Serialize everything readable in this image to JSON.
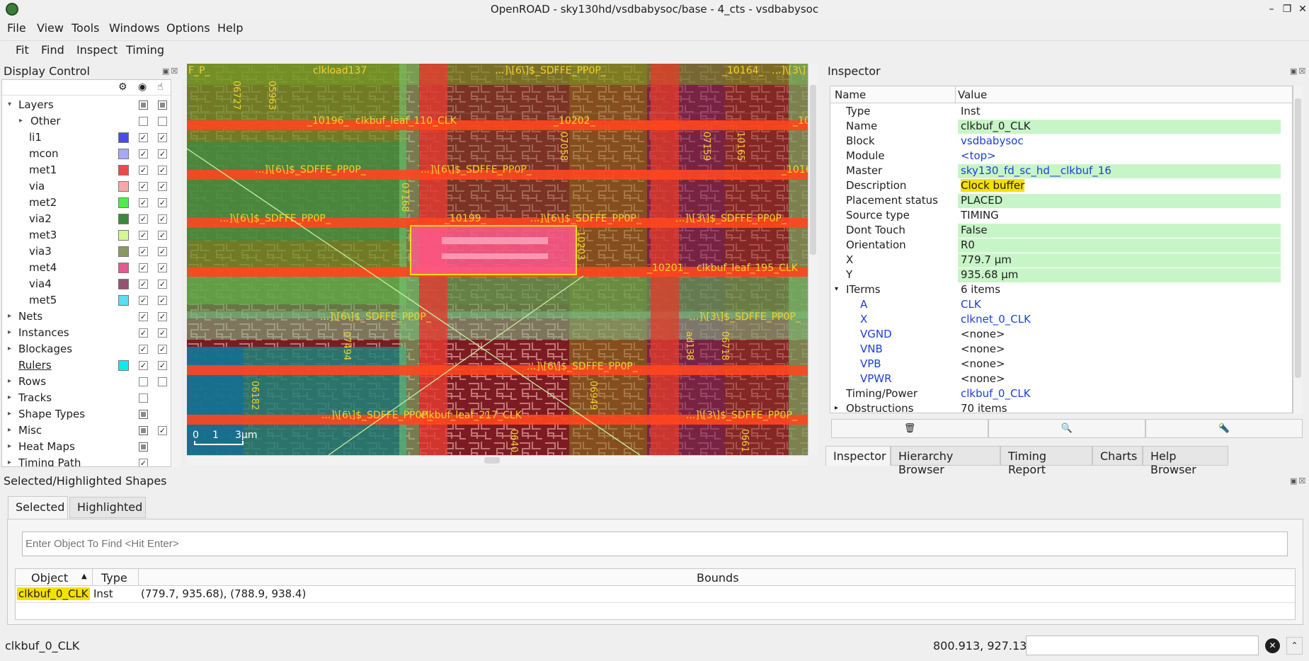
{
  "window": {
    "title": "OpenROAD - sky130hd/vsdbabysoc/base - 4_cts - vsdbabysoc"
  },
  "menu": [
    "File",
    "View",
    "Tools",
    "Windows",
    "Options",
    "Help"
  ],
  "toolbar": [
    "Fit",
    "Find",
    "Inspect",
    "Timing"
  ],
  "display_control": {
    "title": "Display Control",
    "rows": [
      {
        "label": "Layers",
        "level": 0,
        "arrow": "down",
        "color": null,
        "visible": "partial",
        "selectable": "partial"
      },
      {
        "label": "Other",
        "level": 1,
        "arrow": "right",
        "color": null,
        "visible": "off",
        "selectable": "off"
      },
      {
        "label": "li1",
        "level": 1,
        "arrow": "",
        "color": "#4a4af0",
        "visible": "on",
        "selectable": "on"
      },
      {
        "label": "mcon",
        "level": 1,
        "arrow": "",
        "color": "#a8a8f8",
        "visible": "on",
        "selectable": "on"
      },
      {
        "label": "met1",
        "level": 1,
        "arrow": "",
        "color": "#f04848",
        "visible": "on",
        "selectable": "on"
      },
      {
        "label": "via",
        "level": 1,
        "arrow": "",
        "color": "#f8a8a8",
        "visible": "on",
        "selectable": "on"
      },
      {
        "label": "met2",
        "level": 1,
        "arrow": "",
        "color": "#48f048",
        "visible": "on",
        "selectable": "on"
      },
      {
        "label": "via2",
        "level": 1,
        "arrow": "",
        "color": "#3a8a3a",
        "visible": "on",
        "selectable": "on"
      },
      {
        "label": "met3",
        "level": 1,
        "arrow": "",
        "color": "#d4f890",
        "visible": "on",
        "selectable": "on"
      },
      {
        "label": "via3",
        "level": 1,
        "arrow": "",
        "color": "#8a9a60",
        "visible": "on",
        "selectable": "on"
      },
      {
        "label": "met4",
        "level": 1,
        "arrow": "",
        "color": "#e85890",
        "visible": "on",
        "selectable": "on"
      },
      {
        "label": "via4",
        "level": 1,
        "arrow": "",
        "color": "#9a5070",
        "visible": "on",
        "selectable": "on"
      },
      {
        "label": "met5",
        "level": 1,
        "arrow": "",
        "color": "#58e0f0",
        "visible": "on",
        "selectable": "on"
      },
      {
        "label": "Nets",
        "level": 0,
        "arrow": "right",
        "color": null,
        "visible": "on",
        "selectable": "on"
      },
      {
        "label": "Instances",
        "level": 0,
        "arrow": "right",
        "color": null,
        "visible": "on",
        "selectable": "on"
      },
      {
        "label": "Blockages",
        "level": 0,
        "arrow": "right",
        "color": null,
        "visible": "on",
        "selectable": "on"
      },
      {
        "label": "Rulers",
        "level": 0,
        "arrow": "",
        "color": "#00f0f0",
        "visible": "on",
        "selectable": "on"
      },
      {
        "label": "Rows",
        "level": 0,
        "arrow": "right",
        "color": null,
        "visible": "off",
        "selectable": "off"
      },
      {
        "label": "Tracks",
        "level": 0,
        "arrow": "right",
        "color": null,
        "visible": "off",
        "selectable": null
      },
      {
        "label": "Shape Types",
        "level": 0,
        "arrow": "right",
        "color": null,
        "visible": "partial",
        "selectable": null
      },
      {
        "label": "Misc",
        "level": 0,
        "arrow": "right",
        "color": null,
        "visible": "partial",
        "selectable": "on"
      },
      {
        "label": "Heat Maps",
        "level": 0,
        "arrow": "right",
        "color": null,
        "visible": "partial",
        "selectable": null
      },
      {
        "label": "Timing Path",
        "level": 0,
        "arrow": "right",
        "color": null,
        "visible": "on",
        "selectable": null
      }
    ]
  },
  "layout": {
    "labels_h": [
      "F_P_",
      "clkload137",
      "...]\\[6\\]$_SDFFE_PP0P_",
      "_10164_",
      "...]\\[3\\]",
      "_10196_",
      "clkbuf_leaf_110_CLK",
      "_10202_",
      "_10",
      "...]\\[6\\]$_SDFFE_PP0P_",
      "...]\\[6\\]$_SDFFE_PP0P_",
      "_1016",
      "...]\\[6\\]$_SDFFE_PP0P_",
      "_10199_",
      "...]\\[6\\]$_SDFFE_PP0P_",
      "...]\\[3\\]$_SDFFE_PP0P_",
      "_10201_",
      "clkbuf_leaf_195_CLK",
      "...]\\[6\\]$_SDFFE_PP0P_",
      "...]\\[3\\]$_SDFFE_PP0P_",
      "...]\\[6\\]$_SDFFE_PP0P_",
      "...]\\[6\\]$_SDFFE_PP0P_",
      "clkbuf_leaf_217_CLK",
      "...]\\[3\\]$_SDFFE_PP0P_"
    ],
    "labels_v": [
      "06727",
      "05963",
      "07168",
      "07058",
      "07159",
      "10165",
      "10203",
      "07494",
      "ad138",
      "06718",
      "06182",
      "06949",
      "0640",
      "0661"
    ],
    "scale": {
      "ticks": [
        "0",
        "1"
      ],
      "unit": "3µm"
    }
  },
  "inspector": {
    "title": "Inspector",
    "headers": [
      "Name",
      "Value"
    ],
    "rows": [
      {
        "name": "Type",
        "value": "Inst",
        "style": "",
        "indent": 1,
        "arrow": ""
      },
      {
        "name": "Name",
        "value": "clkbuf_0_CLK",
        "style": "green",
        "indent": 1,
        "arrow": ""
      },
      {
        "name": "Block",
        "value": "vsdbabysoc",
        "style": "link",
        "indent": 1,
        "arrow": ""
      },
      {
        "name": "Module",
        "value": "<top>",
        "style": "link",
        "indent": 1,
        "arrow": ""
      },
      {
        "name": "Master",
        "value": "sky130_fd_sc_hd__clkbuf_16",
        "style": "green link",
        "indent": 1,
        "arrow": ""
      },
      {
        "name": "Description",
        "value": "Clock buffer",
        "style": "yellow",
        "indent": 1,
        "arrow": ""
      },
      {
        "name": "Placement status",
        "value": "PLACED",
        "style": "green",
        "indent": 1,
        "arrow": ""
      },
      {
        "name": "Source type",
        "value": "TIMING",
        "style": "",
        "indent": 1,
        "arrow": ""
      },
      {
        "name": "Dont Touch",
        "value": "False",
        "style": "green",
        "indent": 1,
        "arrow": ""
      },
      {
        "name": "Orientation",
        "value": "R0",
        "style": "green",
        "indent": 1,
        "arrow": ""
      },
      {
        "name": "X",
        "value": "779.7 µm",
        "style": "green",
        "indent": 1,
        "arrow": ""
      },
      {
        "name": "Y",
        "value": "935.68 µm",
        "style": "green",
        "indent": 1,
        "arrow": ""
      },
      {
        "name": "ITerms",
        "value": "6 items",
        "style": "",
        "indent": 1,
        "arrow": "down"
      },
      {
        "name": "A",
        "value": "CLK",
        "style": "link namelink",
        "indent": 2,
        "arrow": ""
      },
      {
        "name": "X",
        "value": "clknet_0_CLK",
        "style": "link namelink",
        "indent": 2,
        "arrow": ""
      },
      {
        "name": "VGND",
        "value": "<none>",
        "style": "namelink",
        "indent": 2,
        "arrow": ""
      },
      {
        "name": "VNB",
        "value": "<none>",
        "style": "namelink",
        "indent": 2,
        "arrow": ""
      },
      {
        "name": "VPB",
        "value": "<none>",
        "style": "namelink",
        "indent": 2,
        "arrow": ""
      },
      {
        "name": "VPWR",
        "value": "<none>",
        "style": "namelink",
        "indent": 2,
        "arrow": ""
      },
      {
        "name": "Timing/Power",
        "value": "clkbuf_0_CLK",
        "style": "link",
        "indent": 1,
        "arrow": ""
      },
      {
        "name": "Obstructions",
        "value": "70 items",
        "style": "",
        "indent": 1,
        "arrow": "right"
      }
    ],
    "tabs": [
      "Inspector",
      "Hierarchy Browser",
      "Timing Report",
      "Charts",
      "Help Browser"
    ]
  },
  "selected_shapes": {
    "title": "Selected/Highlighted Shapes",
    "tabs": [
      "Selected",
      "Highlighted"
    ],
    "find_placeholder": "Enter Object To Find <Hit Enter>",
    "columns": [
      "Object",
      "Type",
      "Bounds"
    ],
    "rows": [
      {
        "object": "clkbuf_0_CLK",
        "type": "Inst",
        "bounds": "(779.7, 935.68), (788.9, 938.4)"
      }
    ]
  },
  "statusbar": {
    "selection": "clkbuf_0_CLK",
    "coords": "800.913, 927.132"
  }
}
